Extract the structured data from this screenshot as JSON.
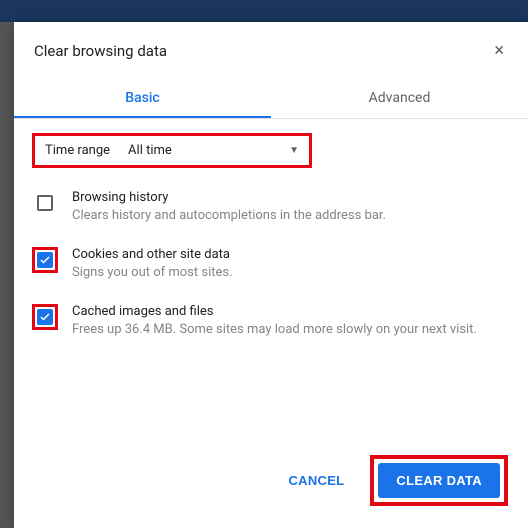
{
  "dialog": {
    "title": "Clear browsing data",
    "close_icon": "×"
  },
  "tabs": {
    "basic": "Basic",
    "advanced": "Advanced"
  },
  "time_range": {
    "label": "Time range",
    "value": "All time"
  },
  "options": [
    {
      "title": "Browsing history",
      "description": "Clears history and autocompletions in the address bar.",
      "checked": false,
      "highlighted": false
    },
    {
      "title": "Cookies and other site data",
      "description": "Signs you out of most sites.",
      "checked": true,
      "highlighted": true
    },
    {
      "title": "Cached images and files",
      "description": "Frees up 36.4 MB. Some sites may load more slowly on your next visit.",
      "checked": true,
      "highlighted": true
    }
  ],
  "footer": {
    "cancel": "CANCEL",
    "clear": "CLEAR DATA"
  },
  "colors": {
    "accent": "#1a73e8",
    "highlight": "#e30613"
  }
}
